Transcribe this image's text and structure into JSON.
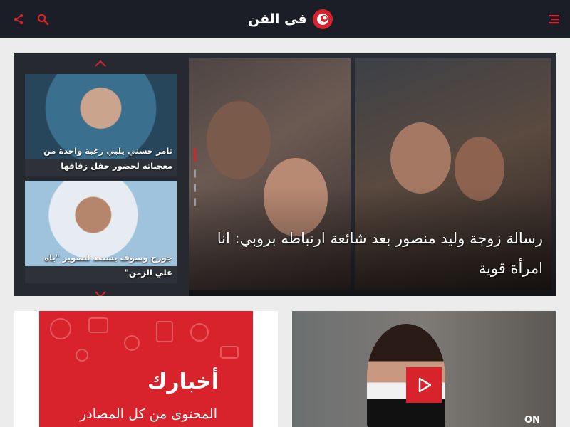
{
  "header": {
    "logo_text": "فى الفن",
    "menu_icon": "menu-icon",
    "share_icon": "share-icon",
    "search_icon": "search-icon",
    "accent_color": "#d9232c",
    "background_color": "#1b1e27"
  },
  "hero": {
    "title": "رسالة زوجة وليد منصور بعد شائعة ارتباطه بروبي: انا امرأة قوية",
    "up_icon": "chevron-up-icon",
    "down_icon": "chevron-down-icon",
    "slides": [
      {
        "title": "تامر حسني يلبي رغبة واحدة من معجباته لحضور حفل زفافها"
      },
      {
        "title": "جورج وسوف يستعد لتصوير \"ياه علي الزمن\""
      }
    ]
  },
  "promo": {
    "brand": "أخبارك",
    "tagline": "المحتوى من كل المصادر"
  },
  "video": {
    "play_icon": "play-icon",
    "channel_badge": "ON"
  }
}
